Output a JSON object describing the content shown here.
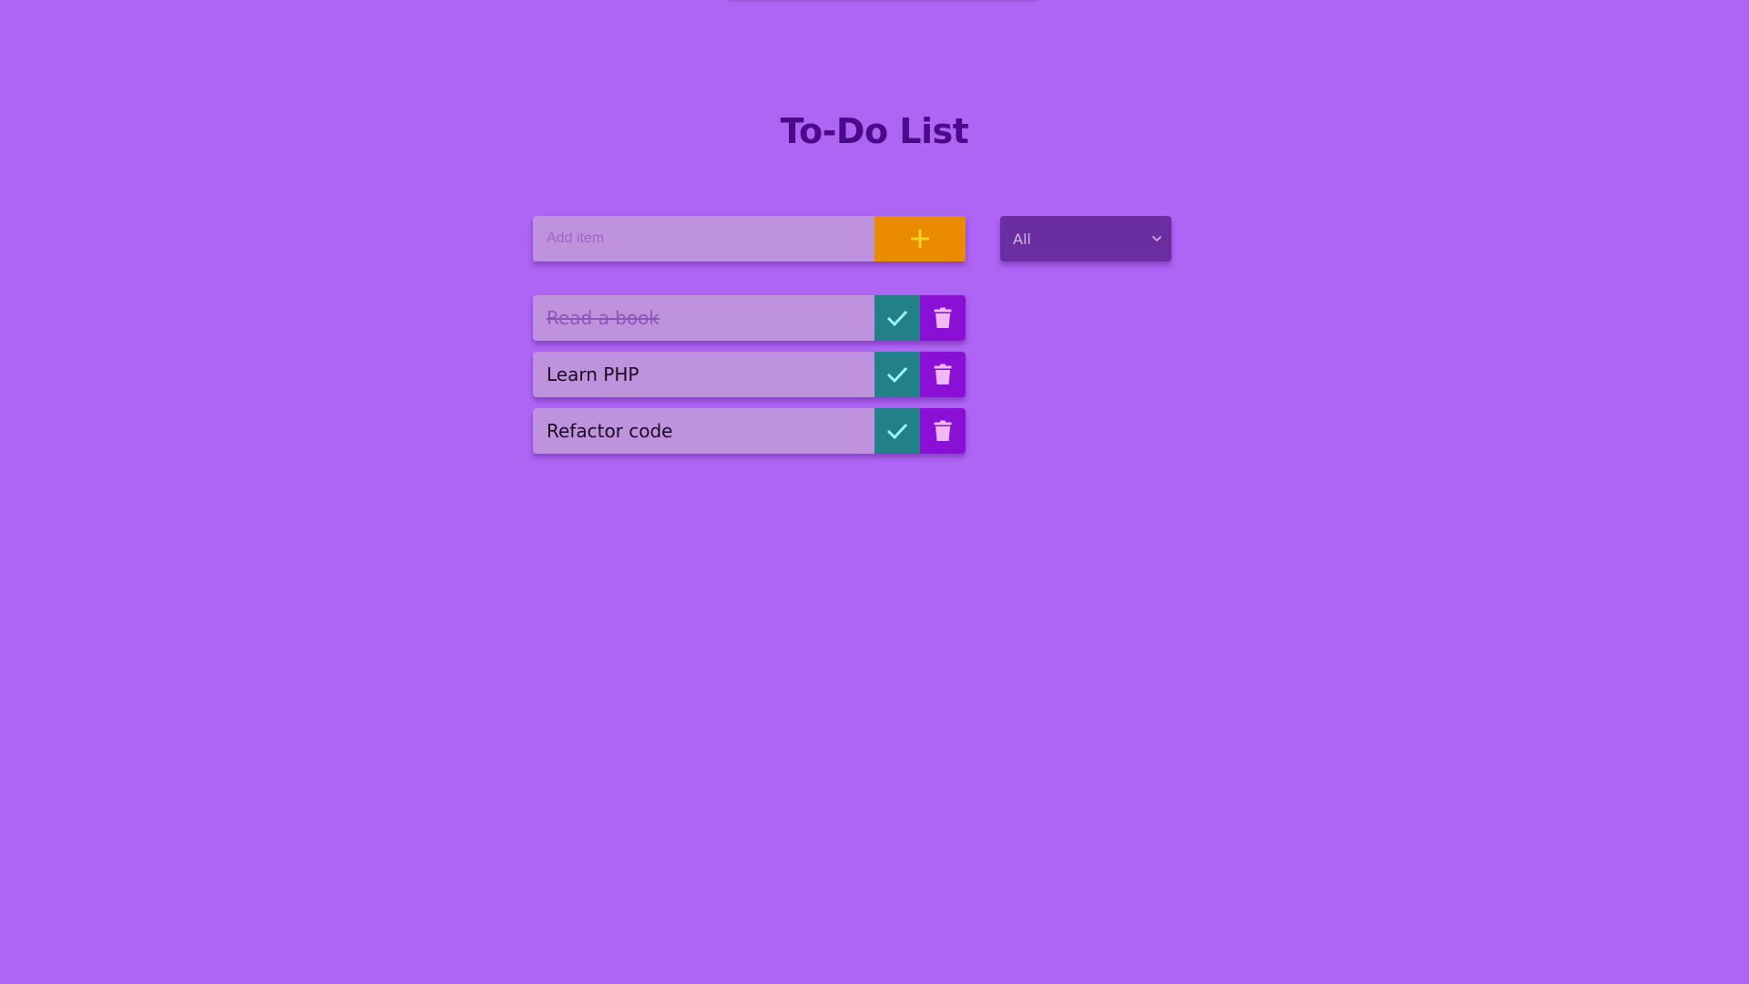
{
  "page": {
    "title": "To-Do List"
  },
  "add_form": {
    "placeholder": "Add item",
    "value": "",
    "button_icon": "plus-icon"
  },
  "filter": {
    "selected": "All",
    "icon": "chevron-down-icon"
  },
  "todos": [
    {
      "text": "Read a book",
      "completed": true
    },
    {
      "text": "Learn PHP",
      "completed": false
    },
    {
      "text": "Refactor code",
      "completed": false
    }
  ],
  "colors": {
    "background": "#ae65f4",
    "title": "#4b0a8a",
    "input_bg": "#be92dd",
    "add_button": "#ea8a00",
    "filter_bg": "#6a2ea0",
    "check_button": "#218088",
    "trash_button": "#8a10d6"
  }
}
